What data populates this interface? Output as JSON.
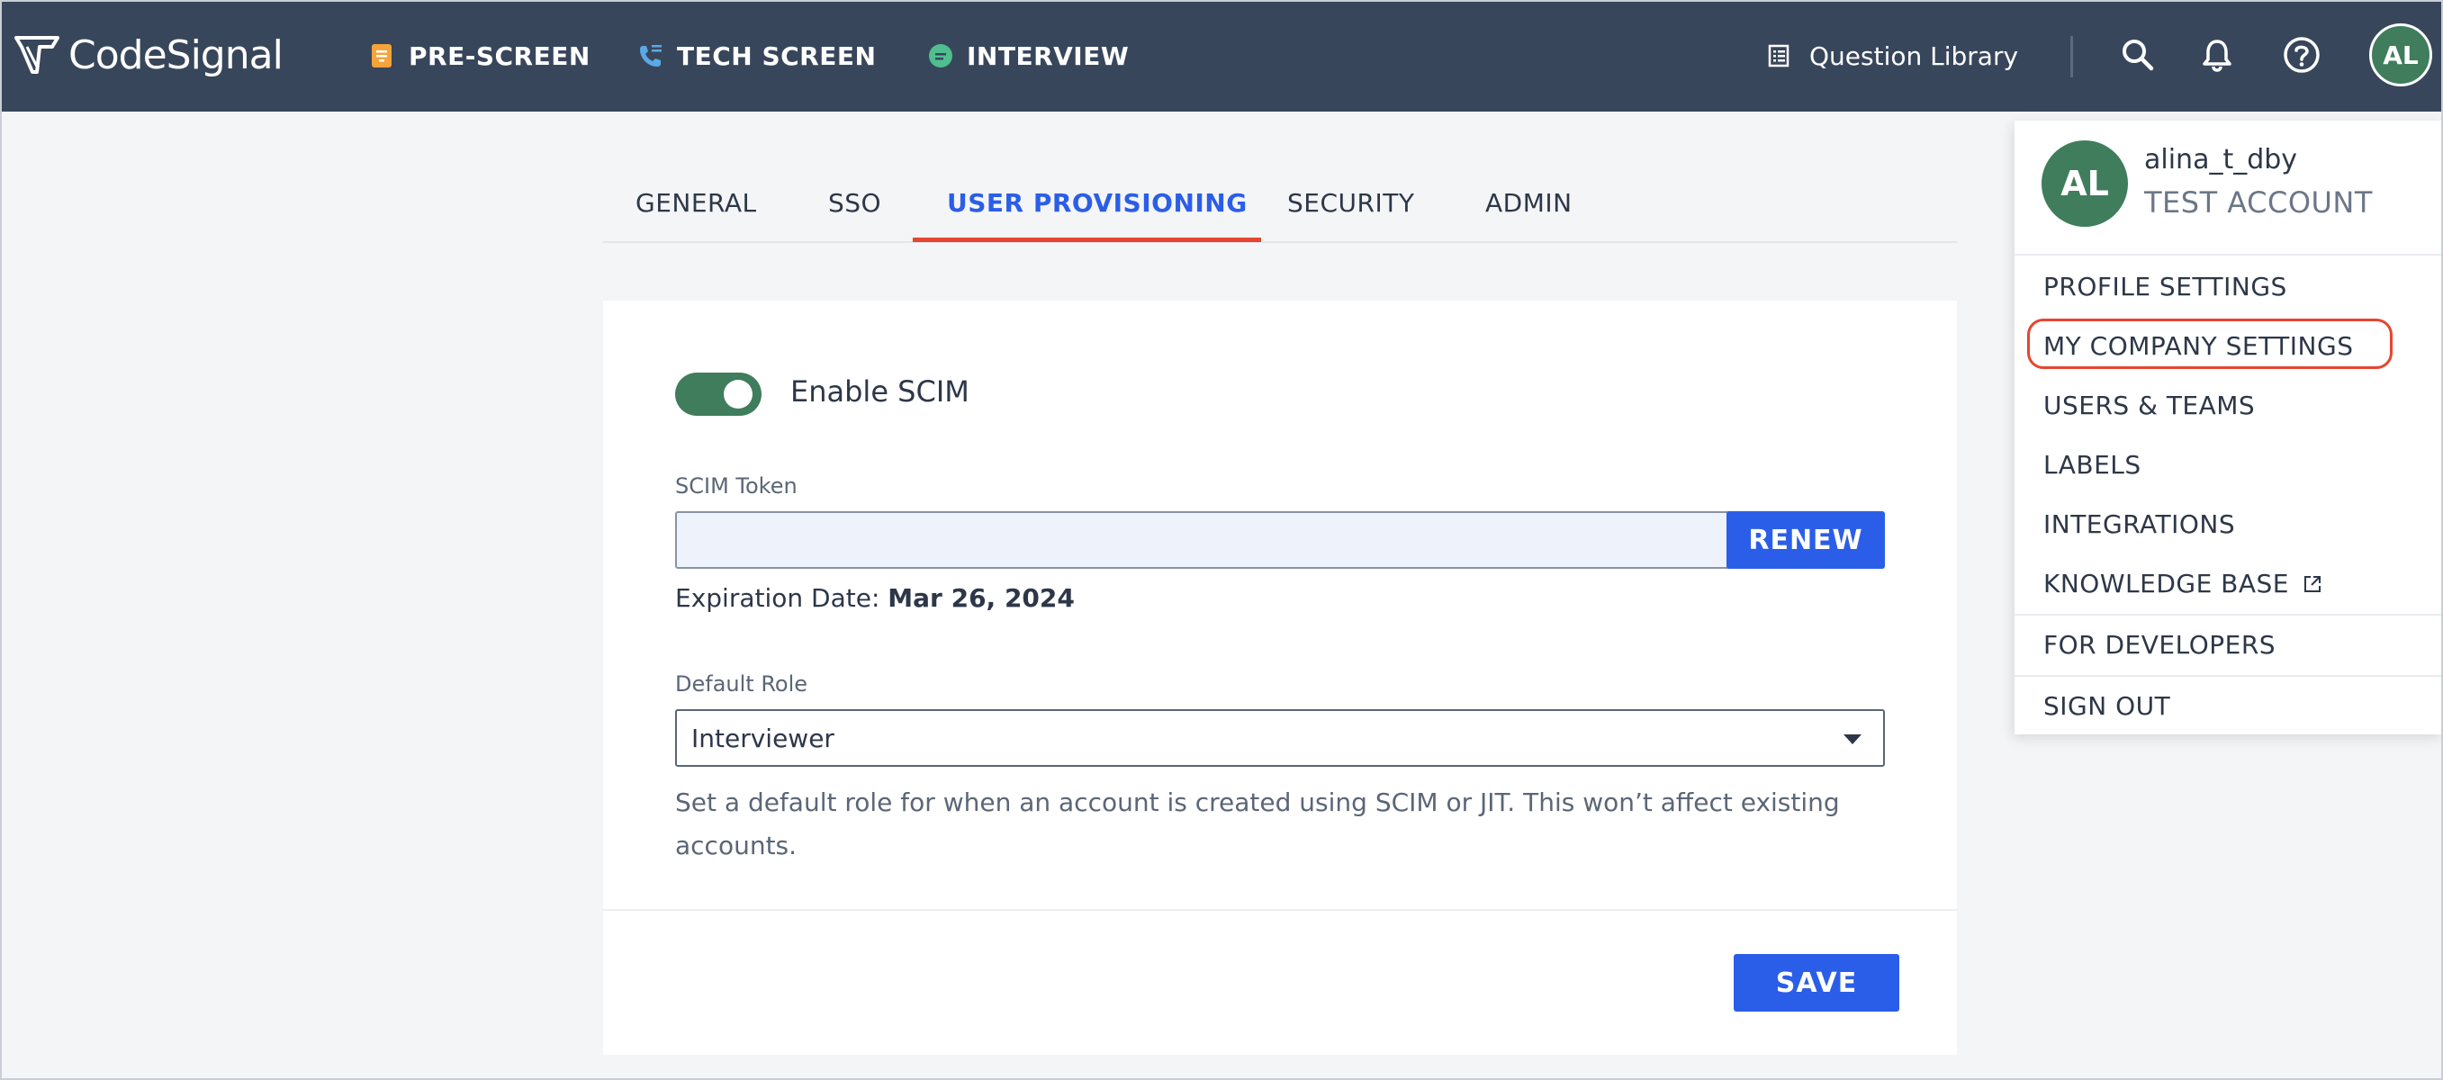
{
  "brand": {
    "name": "CodeSignal"
  },
  "nav": {
    "items": [
      {
        "label": "PRE-SCREEN",
        "icon": "pre-screen-icon",
        "color": "#f6a33a"
      },
      {
        "label": "TECH SCREEN",
        "icon": "tech-screen-icon",
        "color": "#5aa9e6"
      },
      {
        "label": "INTERVIEW",
        "icon": "interview-icon",
        "color": "#4fbf8f"
      }
    ],
    "question_library": "Question Library",
    "avatar_initials": "AL"
  },
  "tabs": [
    {
      "label": "GENERAL",
      "active": false
    },
    {
      "label": "SSO",
      "active": false
    },
    {
      "label": "USER PROVISIONING",
      "active": true
    },
    {
      "label": "SECURITY",
      "active": false
    },
    {
      "label": "ADMIN",
      "active": false
    }
  ],
  "scim": {
    "toggle_label": "Enable SCIM",
    "enabled": true,
    "token_label": "SCIM Token",
    "token_value": "",
    "renew_label": "RENEW",
    "expiry_prefix": "Expiration Date: ",
    "expiry_date": "Mar 26, 2024",
    "role_label": "Default Role",
    "role_value": "Interviewer",
    "helper_text": "Set a default role for when an account is created using SCIM or JIT. This won’t affect existing accounts.",
    "save_label": "SAVE"
  },
  "menu": {
    "avatar_initials": "AL",
    "username": "alina_t_dby",
    "account_type": "TEST ACCOUNT",
    "items": [
      "PROFILE SETTINGS",
      "MY COMPANY SETTINGS",
      "USERS & TEAMS",
      "LABELS",
      "INTEGRATIONS",
      "KNOWLEDGE BASE",
      "FOR DEVELOPERS",
      "SIGN OUT"
    ]
  },
  "colors": {
    "topbar": "#38465b",
    "accent_blue": "#2b5ee8",
    "accent_green": "#3f7d5c",
    "highlight_red": "#e5462f"
  }
}
